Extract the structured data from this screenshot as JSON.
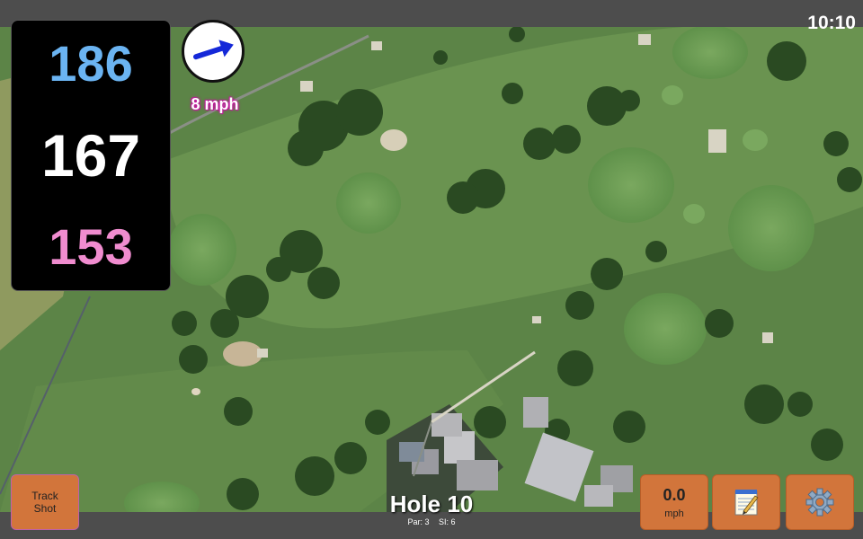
{
  "status": {
    "time": "10:10"
  },
  "distances": {
    "back": "186",
    "middle": "167",
    "front": "153"
  },
  "wind": {
    "speed_label": "8 mph",
    "direction_icon": "arrow-east-icon"
  },
  "hole": {
    "title": "Hole 10",
    "par": "Par: 3",
    "si": "SI: 6"
  },
  "buttons": {
    "track_shot": [
      "Track",
      "Shot"
    ],
    "wind_value": "0.0",
    "wind_unit": "mph",
    "notes_icon": "notepad-icon",
    "settings_icon": "gear-icon"
  },
  "colors": {
    "back_distance": "#6bb4f2",
    "mid_distance": "#ffffff",
    "front_distance": "#f08ccf",
    "button": "#d2753b",
    "wind_arrow": "#1428d8"
  }
}
